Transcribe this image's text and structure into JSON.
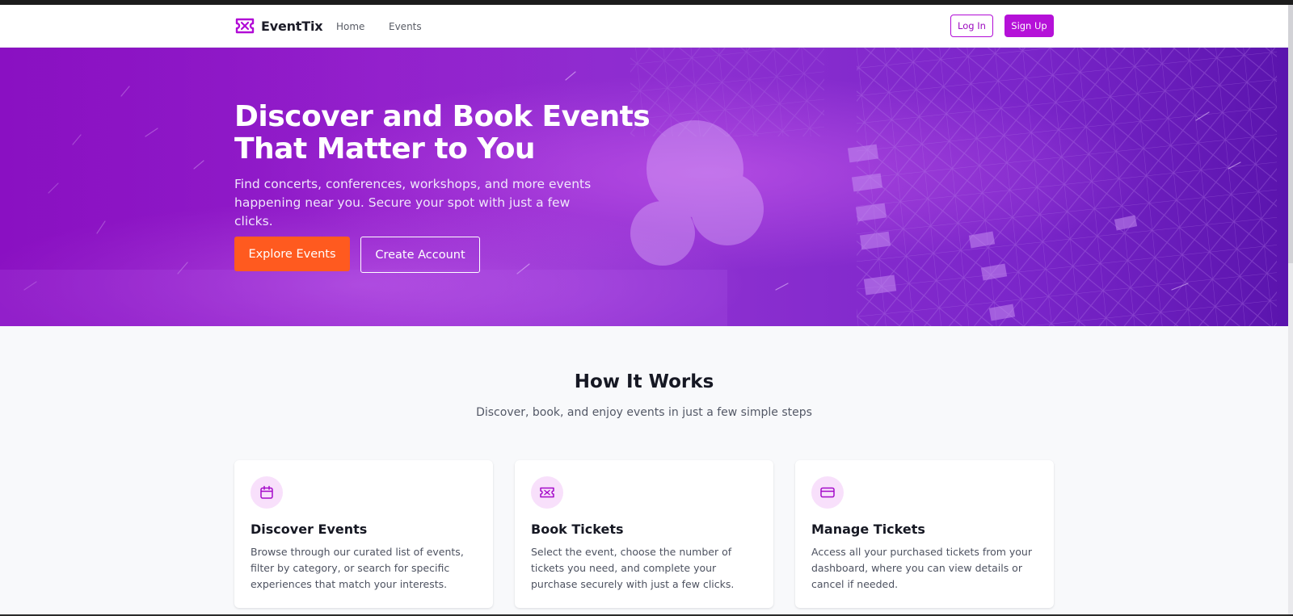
{
  "nav": {
    "brand_name": "EventTix",
    "brand_icon": "ticket-icon",
    "links": [
      "Home",
      "Events"
    ],
    "login_label": "Log In",
    "signup_label": "Sign Up"
  },
  "hero": {
    "title_line1": "Discover and Book Events",
    "title_line2": "That Matter to You",
    "subtitle": "Find concerts, conferences, workshops, and more events happening near you. Secure your spot with just a few clicks.",
    "primary_cta": "Explore Events",
    "secondary_cta": "Create Account"
  },
  "how_it_works": {
    "title": "How It Works",
    "subtitle": "Discover, book, and enjoy events in just a few simple steps",
    "cards": [
      {
        "icon": "calendar-icon",
        "title": "Discover Events",
        "text": "Browse through our curated list of events, filter by category, or search for specific experiences that match your interests."
      },
      {
        "icon": "ticket-icon",
        "title": "Book Tickets",
        "text": "Select the event, choose the number of tickets you need, and complete your purchase securely with just a few clicks."
      },
      {
        "icon": "credit-card-icon",
        "title": "Manage Tickets",
        "text": "Access all your purchased tickets from your dashboard, where you can view details or cancel if needed."
      }
    ]
  },
  "colors": {
    "brand": "#b511d8",
    "cta": "#ff5a1f",
    "hero_gradient_start": "#8a12c4",
    "hero_gradient_end": "#5a14ad",
    "icon_bg": "#f8e0fb"
  }
}
